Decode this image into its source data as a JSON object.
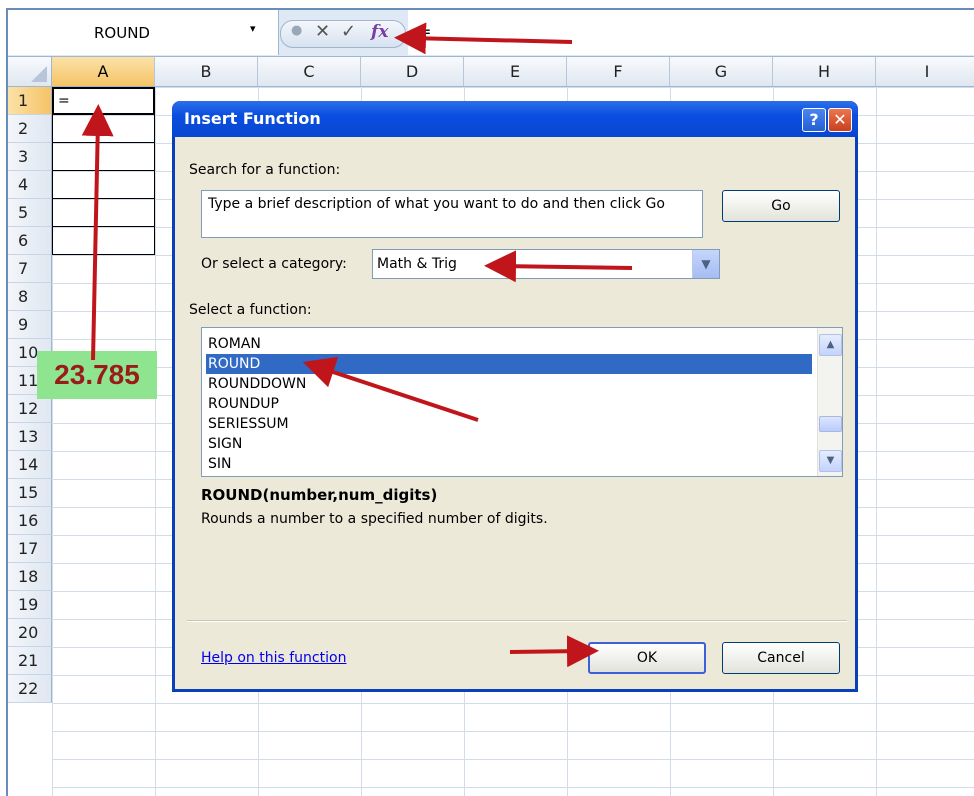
{
  "formula_bar": {
    "name_box": "ROUND",
    "dropdown_glyph": "▾",
    "cancel_glyph": "✕",
    "enter_glyph": "✓",
    "fx_label": "fx",
    "formula": "="
  },
  "grid": {
    "columns": [
      "A",
      "B",
      "C",
      "D",
      "E",
      "F",
      "G",
      "H",
      "I"
    ],
    "rows": [
      "1",
      "2",
      "3",
      "4",
      "5",
      "6",
      "7",
      "8",
      "9",
      "10",
      "11",
      "12",
      "13",
      "14",
      "15",
      "16",
      "17",
      "18",
      "19",
      "20",
      "21",
      "22"
    ],
    "selected_cell": "A1",
    "a1_value": "="
  },
  "callout": {
    "value": "23.785",
    "color": "#8fe58f"
  },
  "dialog": {
    "title": "Insert Function",
    "help_glyph": "?",
    "close_glyph": "✕",
    "search_label": "Search for a function:",
    "search_text": "Type a brief description of what you want to do and then click Go",
    "go_label": "Go",
    "category_label": "Or select a category:",
    "category_value": "Math & Trig",
    "function_label": "Select a function:",
    "functions": [
      "ROMAN",
      "ROUND",
      "ROUNDDOWN",
      "ROUNDUP",
      "SERIESSUM",
      "SIGN",
      "SIN"
    ],
    "selected_function": "ROUND",
    "signature": "ROUND(number,num_digits)",
    "description": "Rounds a number to a specified number of digits.",
    "help_link": "Help on this function",
    "ok_label": "OK",
    "cancel_label": "Cancel"
  },
  "colors": {
    "annotation_arrow": "#c0161b",
    "selection": "#316ac5",
    "titlebar": "#0a4ee0"
  }
}
